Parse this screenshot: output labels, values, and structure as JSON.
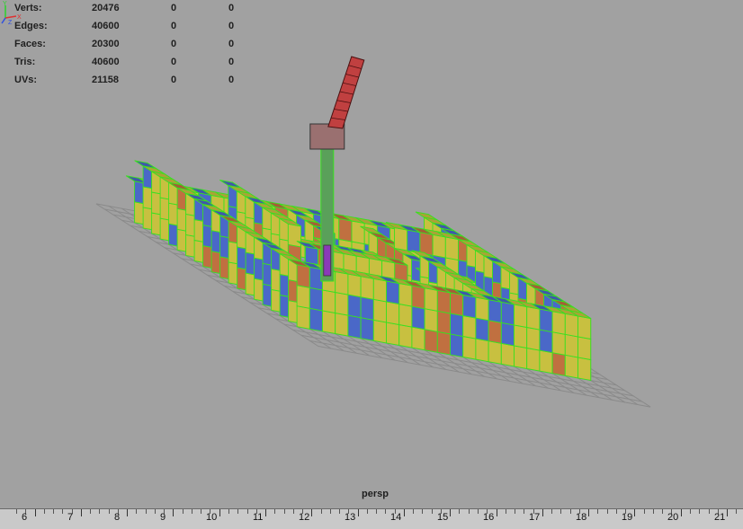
{
  "hud": {
    "rows": [
      {
        "label": "Verts:",
        "v1": "20476",
        "v2": "0",
        "v3": "0"
      },
      {
        "label": "Edges:",
        "v1": "40600",
        "v2": "0",
        "v3": "0"
      },
      {
        "label": "Faces:",
        "v1": "20300",
        "v2": "0",
        "v3": "0"
      },
      {
        "label": "Tris:",
        "v1": "40600",
        "v2": "0",
        "v3": "0"
      },
      {
        "label": "UVs:",
        "v1": "21158",
        "v2": "0",
        "v3": "0"
      }
    ]
  },
  "viewport": {
    "camera_label": "persp"
  },
  "axis_gizmo": {
    "x": "X",
    "y": "Y",
    "z": "Z"
  },
  "timeline": {
    "frames": [
      "6",
      "7",
      "8",
      "9",
      "10",
      "11",
      "12",
      "13",
      "14",
      "15",
      "16",
      "17",
      "18",
      "19",
      "20",
      "21"
    ]
  },
  "colors": {
    "viewport_bg": "#a1a1a1",
    "grid": "#8a8a8a",
    "wire_selected": "#39e020",
    "cube_yellow": "#c8c040",
    "cube_blue": "#4a68c8",
    "cube_orange": "#c07040",
    "tower_red": "#c04040"
  }
}
